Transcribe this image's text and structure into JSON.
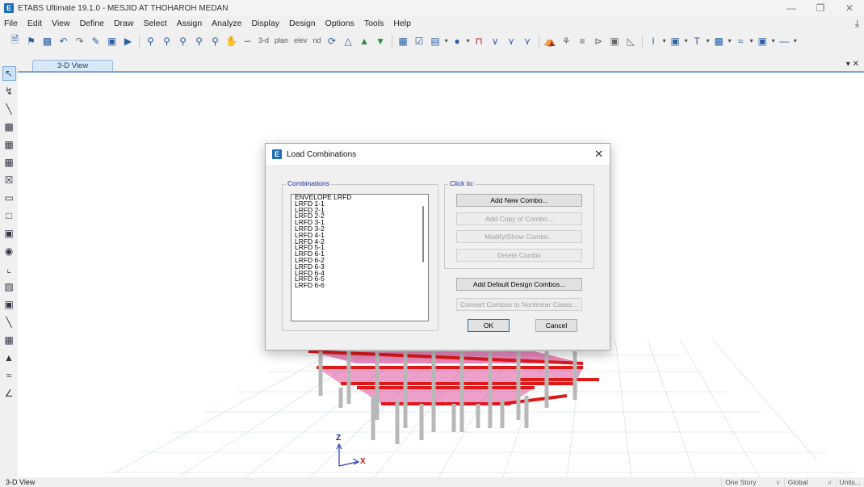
{
  "app": {
    "title": "ETABS Ultimate 19.1.0 - MESJID AT THOHAROH MEDAN",
    "logo_letter": "E"
  },
  "menu": [
    "File",
    "Edit",
    "View",
    "Define",
    "Draw",
    "Select",
    "Assign",
    "Analyze",
    "Display",
    "Design",
    "Options",
    "Tools",
    "Help"
  ],
  "toolbar": {
    "icons": [
      "new-model-icon",
      "open-icon",
      "save-icon",
      "undo-icon",
      "redo-icon",
      "pencil-icon",
      "lock-icon",
      "run-icon",
      "zoom-window-icon",
      "zoom-in-icon",
      "zoom-out-icon",
      "zoom-restore-icon",
      "pan-icon",
      "rubber-band-icon",
      "3d-view-icon"
    ],
    "view_labels": [
      "3-d",
      "plan",
      "elev",
      "nd"
    ]
  },
  "tab": {
    "label": "3-D View"
  },
  "viewport": {
    "axis_z": "Z",
    "axis_x": "X"
  },
  "dialog": {
    "title": "Load Combinations",
    "combinations_label": "Combinations",
    "click_to_label": "Click to:",
    "combinations": [
      "ENVELOPE LRFD",
      "LRFD 1-1",
      "LRFD 2-1",
      "LRFD 2-2",
      "LRFD 3-1",
      "LRFD 3-2",
      "LRFD 4-1",
      "LRFD 4-2",
      "LRFD 5-1",
      "LRFD 6-1",
      "LRFD 6-2",
      "LRFD 6-3",
      "LRFD 6-4",
      "LRFD 6-5",
      "LRFD 6-6"
    ],
    "buttons": {
      "add_new": "Add New Combo...",
      "add_copy": "Add Copy of Combo...",
      "modify_show": "Modify/Show Combo...",
      "delete": "Delete Combo",
      "add_default": "Add Default Design Combos...",
      "convert": "Convert Combos to Nonlinear Cases...",
      "ok": "OK",
      "cancel": "Cancel"
    }
  },
  "status": {
    "left": "3-D View",
    "story": "One Story",
    "coord": "Global",
    "units": "Units..."
  },
  "colors": {
    "accent": "#1c6fb5",
    "slab": "#d92a8a",
    "beam": "#e01818"
  }
}
